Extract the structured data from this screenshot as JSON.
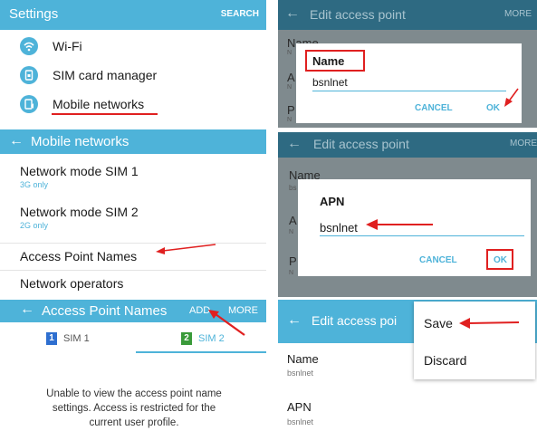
{
  "colors": {
    "bar": "#4eb3d9",
    "accent": "#4eb3d9",
    "annotation_red": "#e02020",
    "dim_overlay": "#7f8a8e",
    "sim2_green": "#3a9a3a",
    "sim1_blue": "#2e6fd0"
  },
  "settings": {
    "title": "Settings",
    "search_label": "SEARCH",
    "items": [
      {
        "icon": "wifi-icon",
        "label": "Wi-Fi"
      },
      {
        "icon": "sim-card-icon",
        "label": "SIM card manager"
      },
      {
        "icon": "mobile-data-icon",
        "label": "Mobile networks"
      }
    ]
  },
  "mobile_networks": {
    "title": "Mobile networks",
    "back_icon": "back-arrow-icon",
    "items": [
      {
        "label": "Network mode SIM 1",
        "sub": "3G only"
      },
      {
        "label": "Network mode SIM 2",
        "sub": "2G only"
      },
      {
        "label": "Access Point Names",
        "sub": ""
      },
      {
        "label": "Network operators",
        "sub": ""
      }
    ]
  },
  "apn_list": {
    "title": "Access Point Names",
    "add_label": "ADD",
    "more_label": "MORE",
    "tabs": [
      {
        "badge": "1",
        "label": "SIM 1"
      },
      {
        "badge": "2",
        "label": "SIM 2"
      }
    ],
    "restricted_message": "Unable to view the access point name settings. Access is restricted for the current user profile."
  },
  "edit_name": {
    "title": "Edit access point",
    "more_label": "MORE",
    "bg_labels": [
      "Name",
      "A",
      "P"
    ],
    "bg_subs": [
      "N",
      "N",
      "N"
    ],
    "dialog": {
      "title": "Name",
      "value": "bsnlnet",
      "cancel_label": "CANCEL",
      "ok_label": "OK"
    }
  },
  "edit_apn": {
    "title": "Edit access point",
    "more_label": "MORE",
    "bg_labels": [
      "Name",
      "A",
      "P"
    ],
    "bg_subs": [
      "bs",
      "N",
      "N"
    ],
    "dialog": {
      "title": "APN",
      "value": "bsnlnet",
      "cancel_label": "CANCEL",
      "ok_label": "OK"
    }
  },
  "edit_save": {
    "title": "Edit access poi",
    "menu": {
      "save_label": "Save",
      "discard_label": "Discard"
    },
    "fields": [
      {
        "label": "Name",
        "value": "bsnlnet"
      },
      {
        "label": "APN",
        "value": "bsnlnet"
      }
    ]
  }
}
